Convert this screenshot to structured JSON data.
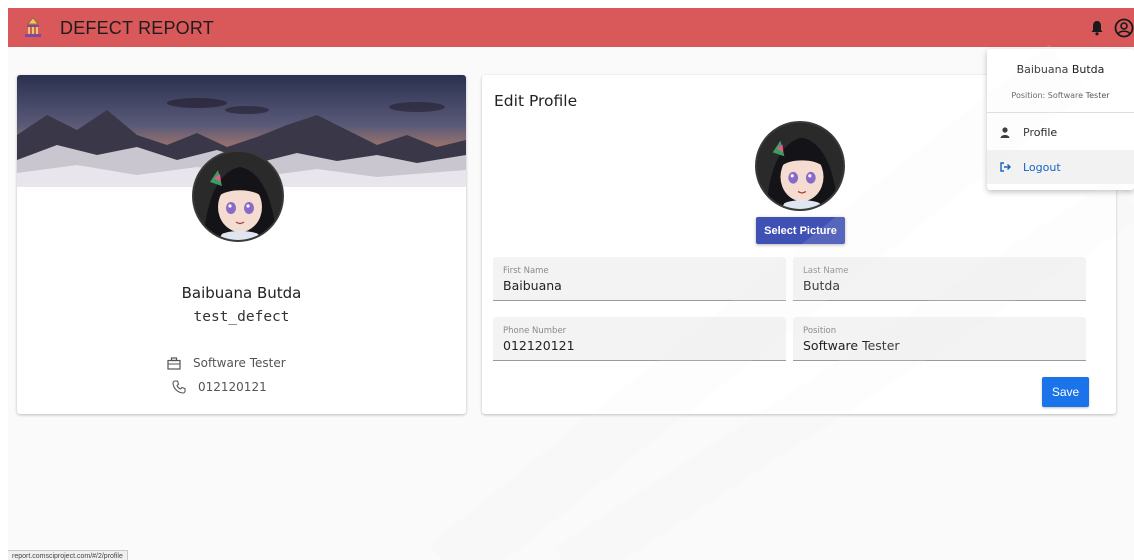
{
  "app": {
    "title": "DEFECT REPORT"
  },
  "colors": {
    "topbar": "#d9585a",
    "primary_button": "#3f51b5",
    "save_button": "#1a73e8",
    "logout": "#1565c0"
  },
  "icons": {
    "logo": "temple-logo-icon",
    "notifications": "bell-icon",
    "account": "account-circle-icon",
    "position": "briefcase-icon",
    "phone": "phone-icon",
    "profile": "user-icon",
    "logout": "logout-icon"
  },
  "profile_card": {
    "name": "Baibuana Butda",
    "username": "test_defect",
    "position": "Software Tester",
    "phone": "012120121"
  },
  "edit_profile": {
    "title": "Edit Profile",
    "select_picture_label": "Select Picture",
    "fields": {
      "first_name": {
        "label": "First Name",
        "value": "Baibuana"
      },
      "last_name": {
        "label": "Last Name",
        "value": "Butda"
      },
      "phone": {
        "label": "Phone Number",
        "value": "012120121"
      },
      "position": {
        "label": "Position",
        "value": "Software Tester"
      }
    },
    "save_label": "Save"
  },
  "account_menu": {
    "name": "Baibuana Butda",
    "position_line": "Position: Software Tester",
    "items": [
      {
        "label": "Profile",
        "icon": "user-icon"
      },
      {
        "label": "Logout",
        "icon": "logout-icon"
      }
    ]
  },
  "status_link": "report.comsciproject.com/#/2/profile"
}
